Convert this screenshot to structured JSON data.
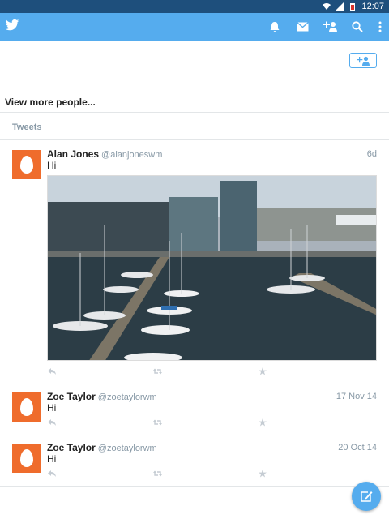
{
  "status_bar": {
    "time": "12:07"
  },
  "colors": {
    "brand": "#55acee",
    "status_bar": "#1e4f7c",
    "avatar": "#ef6c2c",
    "muted": "#8899a6"
  },
  "app_bar": {
    "icons": [
      "twitter-logo",
      "notifications-icon",
      "messages-icon",
      "add-user-icon",
      "search-icon",
      "more-icon"
    ]
  },
  "suggestions": {
    "view_more": "View more people..."
  },
  "tweets_header": "Tweets",
  "tweets": [
    {
      "name": "Alan Jones",
      "handle": "@alanjoneswm",
      "time": "6d",
      "text": "Hi",
      "has_photo": true
    },
    {
      "name": "Zoe Taylor",
      "handle": "@zoetaylorwm",
      "time": "17 Nov 14",
      "text": "Hi",
      "has_photo": false
    },
    {
      "name": "Zoe Taylor",
      "handle": "@zoetaylorwm",
      "time": "20 Oct 14",
      "text": "Hi",
      "has_photo": false
    }
  ]
}
